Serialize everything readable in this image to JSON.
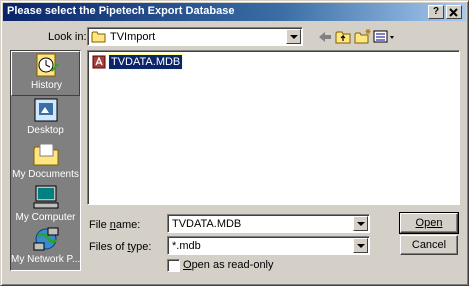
{
  "window": {
    "title": "Please select the Pipetech Export Database",
    "help_button": "?",
    "close_button": "X"
  },
  "look_in": {
    "label": "Look in:",
    "value": "TVImport"
  },
  "toolbar": {
    "icons": [
      "back-icon",
      "up-one-level-icon",
      "create-new-folder-icon",
      "view-menu-icon"
    ]
  },
  "places": [
    {
      "label": "History",
      "icon": "history-icon"
    },
    {
      "label": "Desktop",
      "icon": "desktop-icon"
    },
    {
      "label": "My Documents",
      "icon": "my-documents-icon"
    },
    {
      "label": "My Computer",
      "icon": "my-computer-icon"
    },
    {
      "label": "My Network P...",
      "icon": "my-network-places-icon"
    }
  ],
  "files": [
    {
      "name": "TVDATA.MDB",
      "icon": "access-database-icon",
      "selected": true
    }
  ],
  "file_name": {
    "label": "File name:",
    "value": "TVDATA.MDB"
  },
  "file_type": {
    "label": "Files of type:",
    "value": "*.mdb"
  },
  "read_only": {
    "label": "Open as read-only",
    "checked": false
  },
  "buttons": {
    "open": "Open",
    "cancel": "Cancel"
  },
  "colors": {
    "title_start": "#0a246a",
    "title_end": "#a6caf0",
    "face": "#d4d0c8",
    "selection": "#0a246a"
  }
}
